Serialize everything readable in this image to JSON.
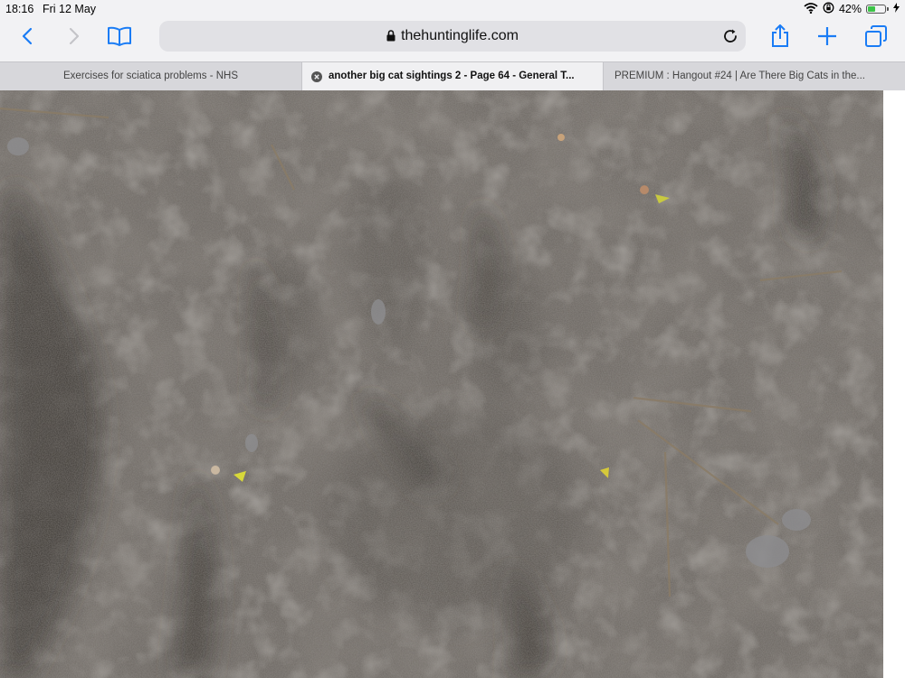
{
  "status": {
    "time": "18:16",
    "date": "Fri 12 May",
    "battery_percent": "42%",
    "battery_level": 0.42,
    "icons": [
      "wifi-icon",
      "orientation-lock-icon",
      "battery-icon",
      "charging-icon"
    ]
  },
  "toolbar": {
    "url": "thehuntinglife.com",
    "icons": [
      "back-icon",
      "forward-icon",
      "bookmarks-icon",
      "reload-icon",
      "share-icon",
      "new-tab-icon",
      "tabs-icon"
    ],
    "accent": "#1a7cf5"
  },
  "tabs": [
    {
      "title": "Exercises for sciatica problems - NHS",
      "active": false
    },
    {
      "title": "another big cat sightings 2 - Page 64 - General T...",
      "active": true
    },
    {
      "title": "PREMIUM : Hangout #24 | Are There Big Cats in the...",
      "active": false
    }
  ],
  "content": {
    "image_alt": ""
  }
}
